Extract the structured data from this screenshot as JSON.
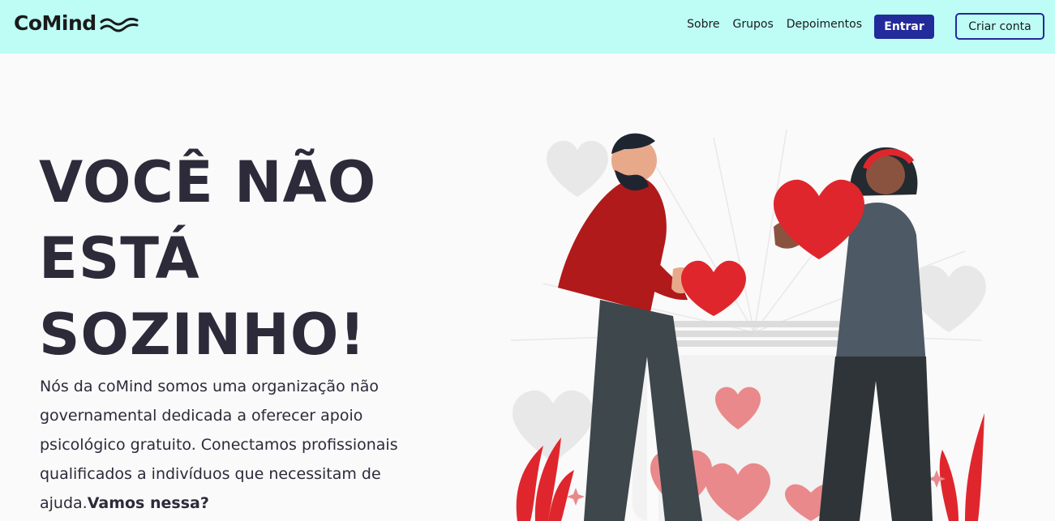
{
  "brand": {
    "name": "CoMind"
  },
  "nav": {
    "links": [
      "Sobre",
      "Grupos",
      "Depoimentos"
    ],
    "login_label": "Entrar",
    "signup_label": "Criar conta"
  },
  "hero": {
    "title_lines": [
      "VOCÊ NÃO",
      "ESTÁ",
      "SOZINHO!"
    ],
    "description": "Nós da coMind somos uma organização não governamental dedicada a oferecer apoio psicológico gratuito. Conectamos profissionais qualificados a indivíduos que necessitam de ajuda.",
    "cta_text": "Vamos nessa?"
  },
  "colors": {
    "navbar_bg": "#bdfdf5",
    "primary": "#232a9a",
    "text": "#2d2a3a",
    "heart_red": "#e0262d"
  }
}
